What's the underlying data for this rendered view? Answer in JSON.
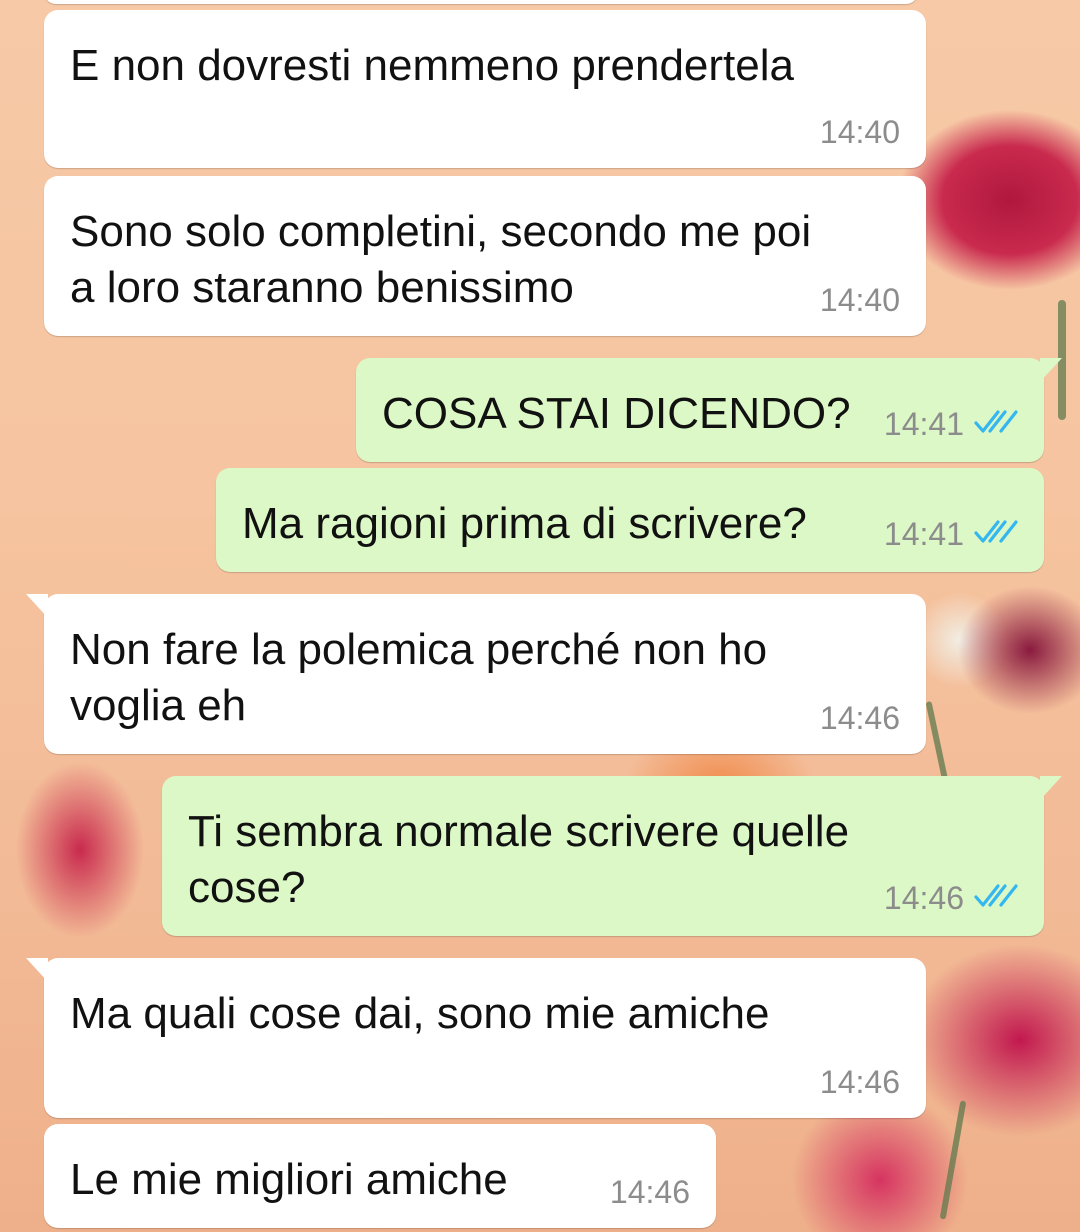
{
  "colors": {
    "incoming_bubble": "#ffffff",
    "outgoing_bubble": "#dcf8c6",
    "timestamp": "#8c8c8c",
    "read_receipt": "#34b7f1"
  },
  "messages": [
    {
      "direction": "incoming",
      "text": "E non dovresti nemmeno prendertela",
      "time": "14:40"
    },
    {
      "direction": "incoming",
      "text": "Sono solo completini, secondo me poi\na loro staranno benissimo",
      "time": "14:40"
    },
    {
      "direction": "outgoing",
      "text": "COSA STAI DICENDO?",
      "time": "14:41",
      "status_icon": "double-check-read-icon"
    },
    {
      "direction": "outgoing",
      "text": "Ma ragioni prima di scrivere?",
      "time": "14:41",
      "status_icon": "double-check-read-icon"
    },
    {
      "direction": "incoming",
      "text": "Non fare la polemica perché non ho\nvoglia eh",
      "time": "14:46"
    },
    {
      "direction": "outgoing",
      "text": "Ti sembra normale scrivere quelle\ncose?",
      "time": "14:46",
      "status_icon": "double-check-read-icon"
    },
    {
      "direction": "incoming",
      "text": "Ma quali cose dai, sono mie amiche",
      "time": "14:46"
    },
    {
      "direction": "incoming",
      "text": "Le mie migliori amiche",
      "time": "14:46"
    }
  ]
}
